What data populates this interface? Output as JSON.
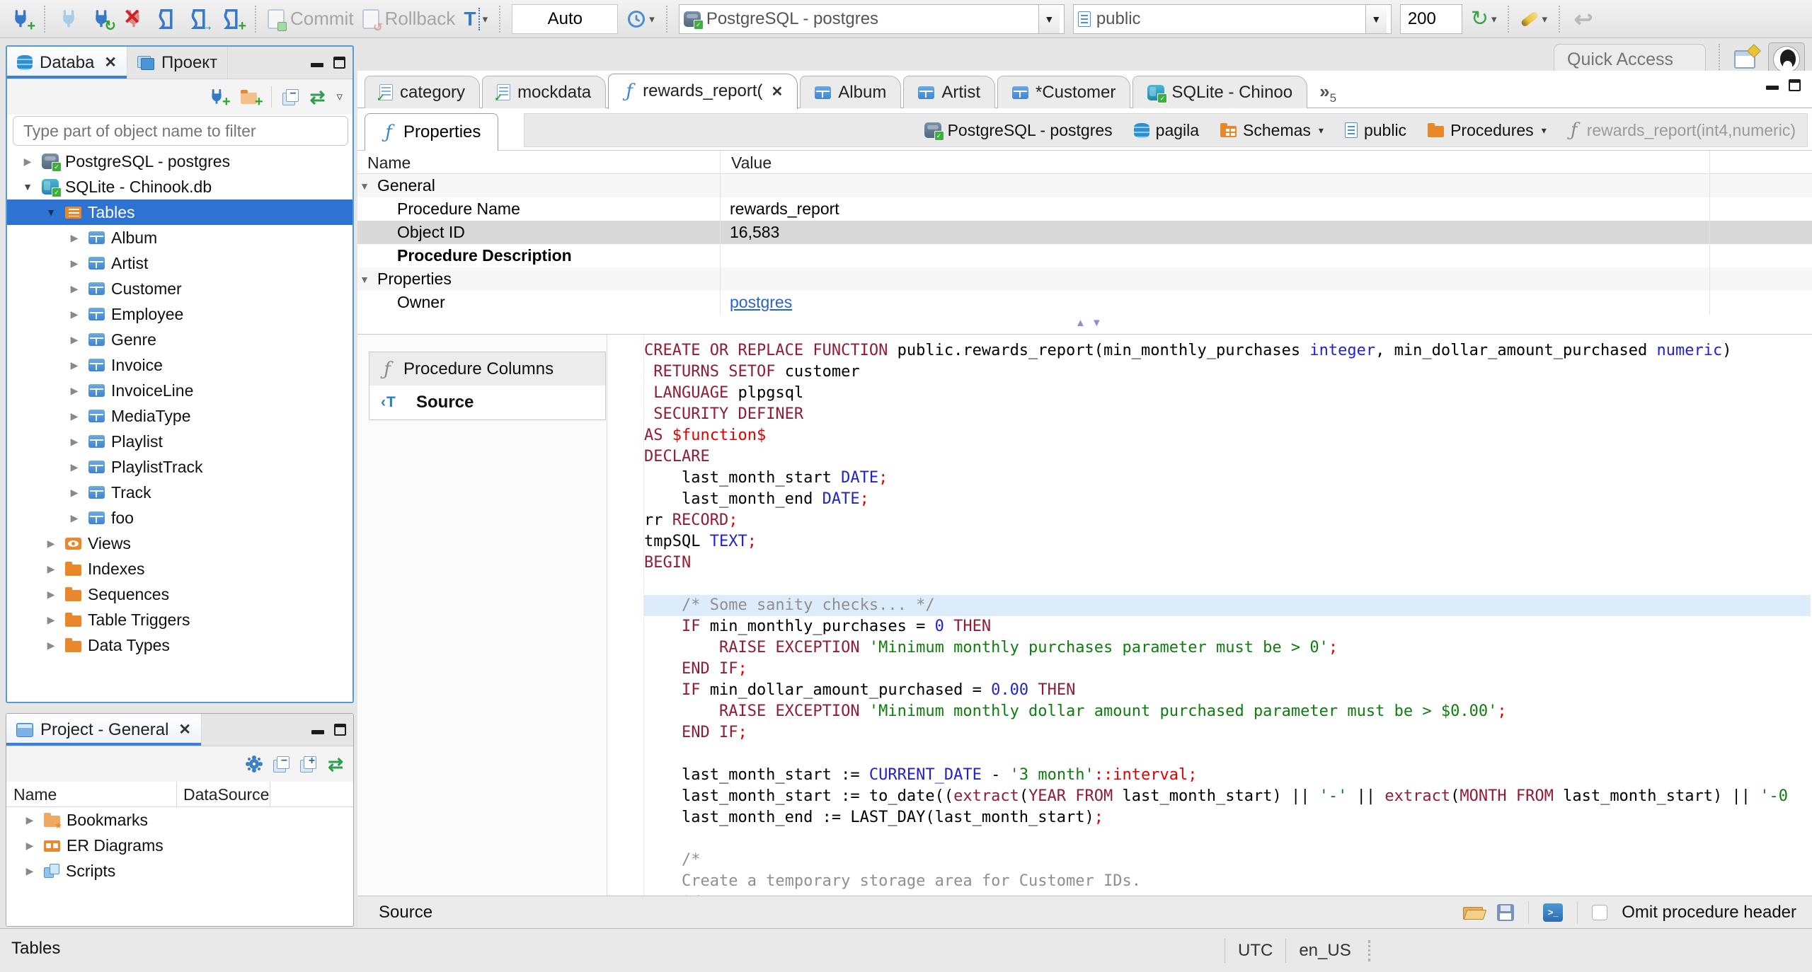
{
  "toolbar": {
    "commit": "Commit",
    "rollback": "Rollback",
    "auto": "Auto",
    "connection": "PostgreSQL - postgres",
    "schema": "public",
    "fetch_size": "200"
  },
  "quick_access": {
    "placeholder": "Quick Access"
  },
  "left": {
    "tabs": [
      {
        "label": "Databa"
      },
      {
        "label": "Проект"
      }
    ],
    "filter_placeholder": "Type part of object name to filter",
    "tree": [
      {
        "label": "PostgreSQL - postgres",
        "icon": "pg",
        "level": 0,
        "expand": "collapsed"
      },
      {
        "label": "SQLite - Chinook.db",
        "icon": "sqlite",
        "level": 0,
        "expand": "expanded"
      },
      {
        "label": "Tables",
        "icon": "tables",
        "level": 1,
        "expand": "expanded",
        "selected": true
      },
      {
        "label": "Album",
        "icon": "table",
        "level": 2,
        "expand": "collapsed"
      },
      {
        "label": "Artist",
        "icon": "table",
        "level": 2,
        "expand": "collapsed"
      },
      {
        "label": "Customer",
        "icon": "table",
        "level": 2,
        "expand": "collapsed"
      },
      {
        "label": "Employee",
        "icon": "table",
        "level": 2,
        "expand": "collapsed"
      },
      {
        "label": "Genre",
        "icon": "table",
        "level": 2,
        "expand": "collapsed"
      },
      {
        "label": "Invoice",
        "icon": "table",
        "level": 2,
        "expand": "collapsed"
      },
      {
        "label": "InvoiceLine",
        "icon": "table",
        "level": 2,
        "expand": "collapsed"
      },
      {
        "label": "MediaType",
        "icon": "table",
        "level": 2,
        "expand": "collapsed"
      },
      {
        "label": "Playlist",
        "icon": "table",
        "level": 2,
        "expand": "collapsed"
      },
      {
        "label": "PlaylistTrack",
        "icon": "table",
        "level": 2,
        "expand": "collapsed"
      },
      {
        "label": "Track",
        "icon": "table",
        "level": 2,
        "expand": "collapsed"
      },
      {
        "label": "foo",
        "icon": "table",
        "level": 2,
        "expand": "collapsed"
      },
      {
        "label": "Views",
        "icon": "eye",
        "level": 1,
        "expand": "collapsed"
      },
      {
        "label": "Indexes",
        "icon": "folder",
        "level": 1,
        "expand": "collapsed"
      },
      {
        "label": "Sequences",
        "icon": "folder",
        "level": 1,
        "expand": "collapsed"
      },
      {
        "label": "Table Triggers",
        "icon": "folder",
        "level": 1,
        "expand": "collapsed"
      },
      {
        "label": "Data Types",
        "icon": "folder",
        "level": 1,
        "expand": "collapsed"
      }
    ],
    "project": {
      "title": "Project - General",
      "columns": [
        "Name",
        "DataSource"
      ],
      "items": [
        {
          "label": "Bookmarks",
          "icon": "bookmarks"
        },
        {
          "label": "ER Diagrams",
          "icon": "er"
        },
        {
          "label": "Scripts",
          "icon": "scripts"
        }
      ]
    }
  },
  "editor": {
    "tabs": [
      {
        "label": "category",
        "icon": "script"
      },
      {
        "label": "mockdata",
        "icon": "script"
      },
      {
        "label": "rewards_report(",
        "icon": "func",
        "active": true,
        "close": true
      },
      {
        "label": "Album",
        "icon": "table"
      },
      {
        "label": "Artist",
        "icon": "table"
      },
      {
        "label": "*Customer",
        "icon": "table"
      },
      {
        "label": "SQLite - Chinoo",
        "icon": "sqlite"
      }
    ],
    "more_tabs": "5",
    "properties_tab": "Properties",
    "breadcrumb": [
      {
        "label": "PostgreSQL - postgres",
        "icon": "pg"
      },
      {
        "label": "pagila",
        "icon": "dbcyl"
      },
      {
        "label": "Schemas",
        "icon": "schemas",
        "dropdown": true
      },
      {
        "label": "public",
        "icon": "page"
      },
      {
        "label": "Procedures",
        "icon": "folder",
        "dropdown": true
      },
      {
        "label": "rewards_report(int4,numeric)",
        "icon": "funcgray",
        "dim": true
      }
    ],
    "props": {
      "columns": [
        "Name",
        "Value"
      ],
      "rows": [
        {
          "name": "General",
          "value": "",
          "group": true
        },
        {
          "name": "Procedure Name",
          "value": "rewards_report",
          "level": 1
        },
        {
          "name": "Object ID",
          "value": "16,583",
          "level": 1,
          "selected": true
        },
        {
          "name": "Procedure Description",
          "value": "",
          "level": 1,
          "bold": true
        },
        {
          "name": "Properties",
          "value": "",
          "group": true
        },
        {
          "name": "Owner",
          "value": "postgres",
          "level": 1,
          "link": true
        }
      ]
    },
    "subtabs": [
      {
        "label": "Procedure Columns"
      },
      {
        "label": "Source"
      }
    ],
    "code": [
      {
        "seg": [
          [
            "k",
            "CREATE OR REPLACE FUNCTION "
          ],
          [
            "p",
            "public.rewards_report(min_monthly_purchases "
          ],
          [
            "t",
            "integer"
          ],
          [
            "p",
            ", min_dollar_amount_purchased "
          ],
          [
            "t",
            "numeric"
          ],
          [
            "p",
            ")"
          ]
        ]
      },
      {
        "seg": [
          [
            "p",
            " "
          ],
          [
            "k",
            "RETURNS SETOF "
          ],
          [
            "p",
            "customer"
          ]
        ]
      },
      {
        "seg": [
          [
            "p",
            " "
          ],
          [
            "k",
            "LANGUAGE "
          ],
          [
            "p",
            "plpgsql"
          ]
        ]
      },
      {
        "seg": [
          [
            "p",
            " "
          ],
          [
            "k",
            "SECURITY DEFINER"
          ]
        ]
      },
      {
        "seg": [
          [
            "k",
            "AS "
          ],
          [
            "r",
            "$function$"
          ]
        ]
      },
      {
        "seg": [
          [
            "k",
            "DECLARE"
          ]
        ]
      },
      {
        "seg": [
          [
            "p",
            "    last_month_start "
          ],
          [
            "t",
            "DATE"
          ],
          [
            "r",
            ";"
          ]
        ]
      },
      {
        "seg": [
          [
            "p",
            "    last_month_end "
          ],
          [
            "t",
            "DATE"
          ],
          [
            "r",
            ";"
          ]
        ]
      },
      {
        "seg": [
          [
            "p",
            "rr "
          ],
          [
            "k",
            "RECORD"
          ],
          [
            "r",
            ";"
          ]
        ]
      },
      {
        "seg": [
          [
            "p",
            "tmpSQL "
          ],
          [
            "t",
            "TEXT"
          ],
          [
            "r",
            ";"
          ]
        ]
      },
      {
        "seg": [
          [
            "k",
            "BEGIN"
          ]
        ]
      },
      {
        "seg": []
      },
      {
        "hl": true,
        "seg": [
          [
            "c",
            "    /* Some sanity checks... */"
          ]
        ]
      },
      {
        "seg": [
          [
            "p",
            "    "
          ],
          [
            "k",
            "IF"
          ],
          [
            "p",
            " min_monthly_purchases = "
          ],
          [
            "n",
            "0"
          ],
          [
            "p",
            " "
          ],
          [
            "k",
            "THEN"
          ]
        ]
      },
      {
        "seg": [
          [
            "p",
            "        "
          ],
          [
            "k",
            "RAISE EXCEPTION "
          ],
          [
            "s",
            "'Minimum monthly purchases parameter must be > 0'"
          ],
          [
            "r",
            ";"
          ]
        ]
      },
      {
        "seg": [
          [
            "p",
            "    "
          ],
          [
            "k",
            "END IF"
          ],
          [
            "r",
            ";"
          ]
        ]
      },
      {
        "seg": [
          [
            "p",
            "    "
          ],
          [
            "k",
            "IF"
          ],
          [
            "p",
            " min_dollar_amount_purchased = "
          ],
          [
            "n",
            "0.00"
          ],
          [
            "p",
            " "
          ],
          [
            "k",
            "THEN"
          ]
        ]
      },
      {
        "seg": [
          [
            "p",
            "        "
          ],
          [
            "k",
            "RAISE EXCEPTION "
          ],
          [
            "s",
            "'Minimum monthly dollar amount purchased parameter must be > $0.00'"
          ],
          [
            "r",
            ";"
          ]
        ]
      },
      {
        "seg": [
          [
            "p",
            "    "
          ],
          [
            "k",
            "END IF"
          ],
          [
            "r",
            ";"
          ]
        ]
      },
      {
        "seg": []
      },
      {
        "seg": [
          [
            "p",
            "    last_month_start := "
          ],
          [
            "t",
            "CURRENT_DATE"
          ],
          [
            "p",
            " - "
          ],
          [
            "s",
            "'3 month'"
          ],
          [
            "r",
            "::interval;"
          ]
        ]
      },
      {
        "seg": [
          [
            "p",
            "    last_month_start := to_date(("
          ],
          [
            "k",
            "extract"
          ],
          [
            "p",
            "("
          ],
          [
            "k",
            "YEAR FROM"
          ],
          [
            "p",
            " last_month_start) || "
          ],
          [
            "s",
            "'-'"
          ],
          [
            "p",
            " || "
          ],
          [
            "k",
            "extract"
          ],
          [
            "p",
            "("
          ],
          [
            "k",
            "MONTH FROM"
          ],
          [
            "p",
            " last_month_start) || "
          ],
          [
            "s",
            "'-0"
          ]
        ]
      },
      {
        "seg": [
          [
            "p",
            "    last_month_end := LAST_DAY(last_month_start)"
          ],
          [
            "r",
            ";"
          ]
        ]
      },
      {
        "seg": []
      },
      {
        "seg": [
          [
            "c",
            "    /*"
          ]
        ]
      },
      {
        "seg": [
          [
            "c",
            "    Create a temporary storage area for Customer IDs."
          ]
        ]
      },
      {
        "seg": [
          [
            "c",
            "    */"
          ]
        ]
      }
    ],
    "bottom_label": "Source",
    "omit_label": "Omit procedure header"
  },
  "status": {
    "left": "Tables",
    "timezone": "UTC",
    "locale": "en_US"
  }
}
